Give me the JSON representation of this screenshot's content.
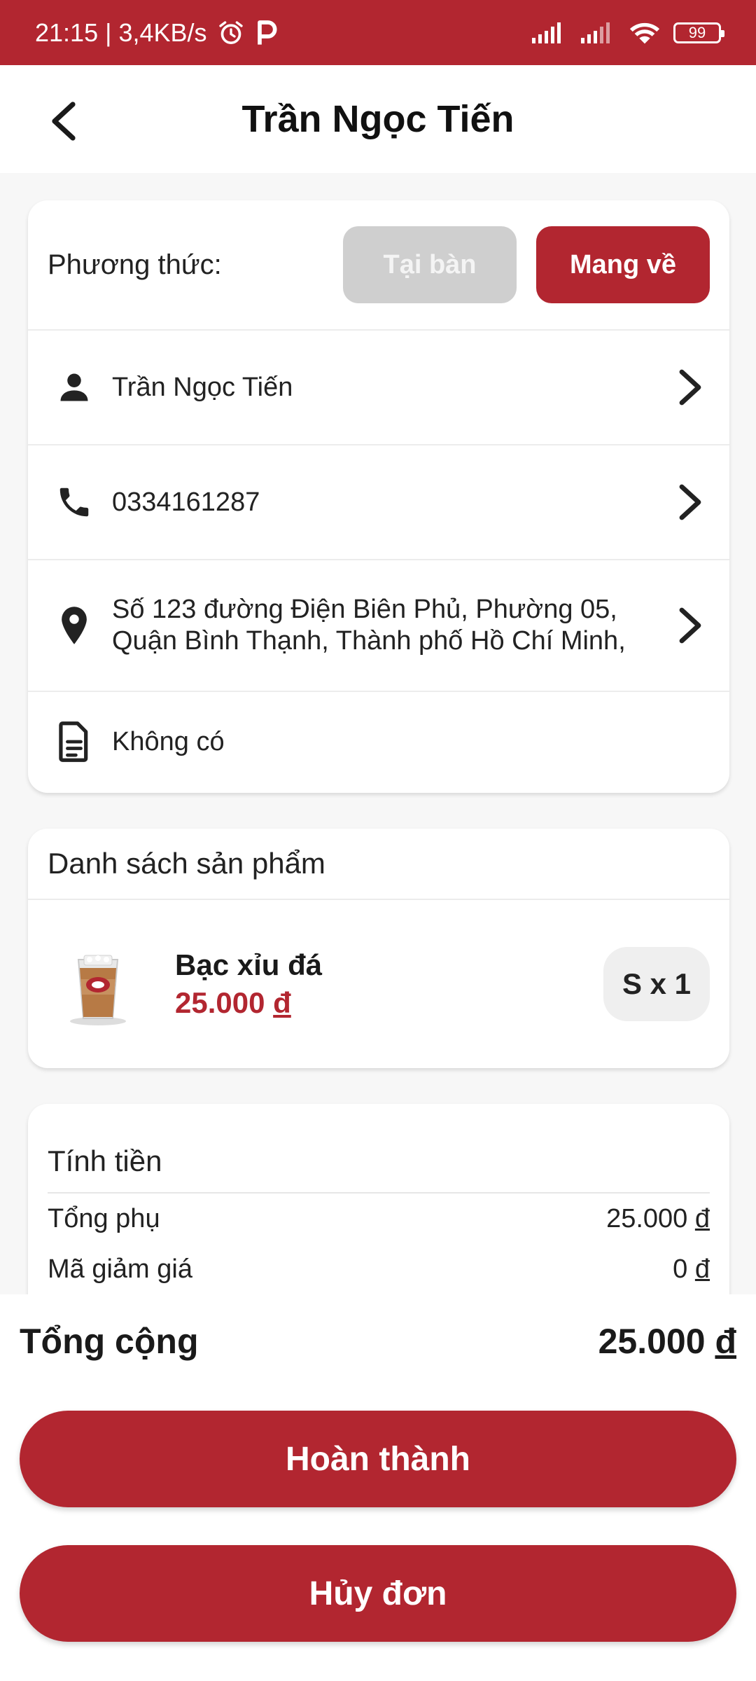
{
  "status_bar": {
    "time_info": "21:15 | 3,4KB/s",
    "battery": "99",
    "icons": [
      "alarm-icon",
      "p-icon",
      "signal-icon",
      "signal-icon-2",
      "wifi-icon",
      "battery-icon"
    ]
  },
  "header": {
    "title": "Trần Ngọc Tiến",
    "back_icon": "chevron-left-icon"
  },
  "method": {
    "label": "Phương thức:",
    "option_dine_in": "Tại bàn",
    "option_takeaway": "Mang về",
    "selected": "Mang về"
  },
  "customer": {
    "name": "Trần Ngọc Tiến",
    "phone": "0334161287",
    "address": "Số 123 đường Điện Biên Phủ, Phường 05, Quận Bình Thạnh, Thành phố Hồ Chí Minh,",
    "note": "Không có"
  },
  "products": {
    "title": "Danh sách sản phẩm",
    "items": [
      {
        "name": "Bạc xỉu đá",
        "price": "25.000",
        "currency": "đ",
        "size_qty": "S x 1"
      }
    ]
  },
  "bill": {
    "title": "Tính tiền",
    "subtotal_label": "Tổng phụ",
    "subtotal_value": "25.000",
    "discount_label": "Mã giảm giá",
    "discount_value": "0",
    "currency": "đ"
  },
  "footer": {
    "total_label": "Tổng cộng",
    "total_value": "25.000",
    "currency": "đ",
    "complete_button": "Hoàn thành",
    "cancel_button": "Hủy đơn"
  },
  "colors": {
    "brand": "#b22630",
    "disabled": "#cfcfcf"
  }
}
